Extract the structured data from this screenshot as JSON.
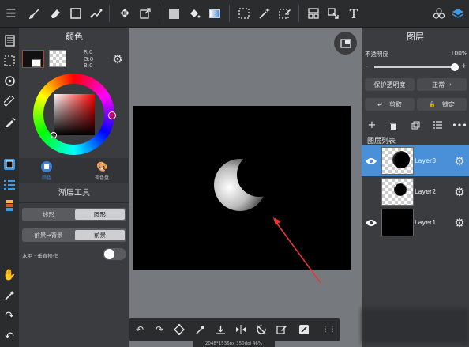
{
  "toolbar": {
    "icons": [
      "menu-icon",
      "brush-icon",
      "eraser-icon",
      "select-rect-icon",
      "sparkle-icon",
      "move-icon",
      "transform-icon",
      "fill-color-icon",
      "bucket-icon",
      "gradient-icon",
      "lasso-rect-icon",
      "magic-wand-icon",
      "select-pen-icon",
      "panel-icon",
      "cursor-icon",
      "text-icon",
      "material-icon",
      "layers-icon"
    ]
  },
  "color_panel": {
    "title": "颜色",
    "rgb_r": "R:0",
    "rgb_g": "G:0",
    "rgb_b": "B:0",
    "tab_wheel": "颜色",
    "tab_palette": "调色盘",
    "accent": "#3d7fd1"
  },
  "gradient_panel": {
    "title": "渐层工具",
    "shape_linear": "线形",
    "shape_radial": "圆形",
    "mode_fg_bg": "前景→背景",
    "mode_fg": "前景",
    "flip_label": "水平 · 垂直操作"
  },
  "layers_panel": {
    "title": "图层",
    "opacity_label": "不透明度",
    "opacity_value": "100%",
    "opacity_level": 1.0,
    "minus": "-",
    "plus": "+",
    "protect_alpha": "保护透明度",
    "blend_mode": "正常",
    "clipping": "剪取",
    "lock": "锁定",
    "list_title": "图层列表",
    "layers": [
      {
        "name": "Layer3",
        "selected": true,
        "visible": true
      },
      {
        "name": "Layer2",
        "selected": false,
        "visible": false
      },
      {
        "name": "Layer1",
        "selected": false,
        "visible": true
      }
    ]
  },
  "status": {
    "canvas_info": "2048*1536px 350dpi 46%"
  }
}
